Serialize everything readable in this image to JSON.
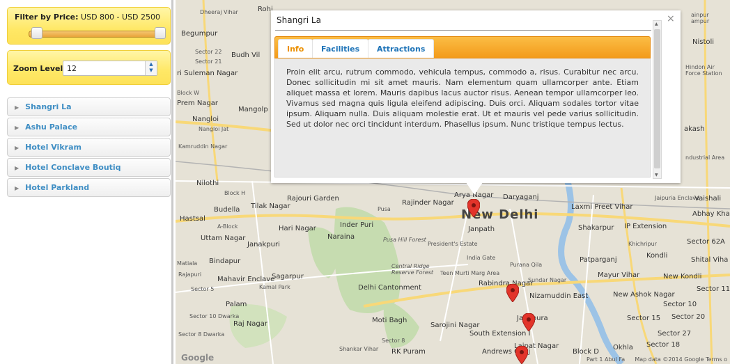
{
  "filters": {
    "price_label": "Filter by Price:",
    "price_range": "USD 800 - USD 2500",
    "zoom_label": "Zoom Level:",
    "zoom_value": "12"
  },
  "hotels": [
    "Shangri La",
    "Ashu Palace",
    "Hotel Vikram",
    "Hotel Conclave Boutiq",
    "Hotel Parkland"
  ],
  "infowindow": {
    "title": "Shangri La",
    "tabs": [
      "Info",
      "Facilities",
      "Attractions"
    ],
    "active_tab": "Info",
    "body": "Proin elit arcu, rutrum commodo, vehicula tempus, commodo a, risus. Curabitur nec arcu. Donec sollicitudin mi sit amet mauris. Nam elementum quam ullamcorper ante. Etiam aliquet massa et lorem. Mauris dapibus lacus auctor risus. Aenean tempor ullamcorper leo. Vivamus sed magna quis ligula eleifend adipiscing. Duis orci. Aliquam sodales tortor vitae ipsum. Aliquam nulla. Duis aliquam molestie erat. Ut et mauris vel pede varius sollicitudin. Sed ut dolor nec orci tincidunt interdum. Phasellus ipsum. Nunc tristique tempus lectus."
  },
  "map": {
    "city": "New Delhi",
    "labels": {
      "dheeraj_vihar": "Dheeraj Vihar",
      "rohini": "Rohi",
      "begumpur": "Begumpur",
      "sector_22": "Sector 22",
      "sector_21": "Sector 21",
      "budh_vihar": "Budh Vil",
      "sultanpuri": "ri Suleman Nagar",
      "block_w": "Block W",
      "prem_nagar": "Prem Nagar",
      "mangolpuri": "Mangolp",
      "nangloi": "Nangloi",
      "nangloi_jat": "Nangloi Jat",
      "kamruddin": "Kamruddin Nagar",
      "nilothi": "Nilothi",
      "block_h": "Block H",
      "budella": "Budella",
      "tilak_nagar": "Tilak Nagar",
      "hastsal": "Hastsal",
      "a_block": "A-Block",
      "hari_nagar": "Hari Nagar",
      "uttam_nagar": "Uttam Nagar",
      "janakpuri": "Janakpuri",
      "bindapur": "Bindapur",
      "matiala": "Matiala",
      "rajapuri": "Rajapuri",
      "mahavir": "Mahavir Enclave",
      "sagarpur": "Sagarpur",
      "sector_5": "Sector 5",
      "kamal_park": "Kamal Park",
      "palam": "Palam",
      "sector_10": "Sector 10 Dwarka",
      "raj_nagar": "Raj Nagar",
      "sector_8": "Sector 8 Dwarka",
      "sector_22b": "Sector 22",
      "rajouri": "Rajouri Garden",
      "inder_puri": "Inder Puri",
      "naraina": "Naraina",
      "pusa": "Pusa",
      "rajinder": "Rajinder Nagar",
      "pusa_hill": "Pusa Hill Forest",
      "central_ridge": "Central Ridge Reserve Forest",
      "delhi_cantt": "Delhi Cantonment",
      "moti_bagh": "Moti Bagh",
      "sarojini": "Sarojini Nagar",
      "sector_8b": "Sector 8",
      "rk_puram": "RK Puram",
      "shankar": "Shankar Vihar",
      "arya_nagar": "Arya Nagar",
      "daryaganj": "Daryaganj",
      "janpath": "Janpath",
      "presidents": "President's Estate",
      "india_gate": "India Gate",
      "purana_qila": "Purana Qila",
      "teen_murti": "Teen Murti Marg Area",
      "rabindra": "Rabindra Nagar",
      "sundar": "Sundar Nagar",
      "nizamuddin": "Nizamuddin East",
      "jangpura": "Jangpura",
      "south_ext": "South Extension I",
      "andrews": "Andrews Ganj",
      "lajpat": "Lajpat Nagar",
      "block_d": "Block D",
      "okhla": "Okhla",
      "part1": "Part 1 Abul Fa",
      "laxmi": "Laxmi Preet Vihar",
      "jaipuria": "Jaipuria Enclave",
      "vaishali": "Vaishali",
      "abhay": "Abhay Khand",
      "shakarpur": "Shakarpur",
      "ip_ext": "IP Extension",
      "sector_62a": "Sector 62A",
      "khichripur": "Khichripur",
      "kondli": "Kondli",
      "patparganj": "Patparganj",
      "shital": "Shital Viha",
      "mayur": "Mayur Vihar",
      "new_kondli": "New Kondli",
      "sector_11": "Sector 11",
      "new_ashok": "New Ashok Nagar",
      "sector_10b": "Sector 10",
      "sector_15": "Sector 15",
      "sector_20": "Sector 20",
      "sector_27": "Sector 27",
      "sector_18": "Sector 18",
      "hindon": "Hindon Air Force Station",
      "akash": "akash",
      "industrial": "ndustrial Area",
      "nistoli": "Nistoli",
      "dilshad": "ainpur ampur"
    },
    "copyright": "Map data ©2014 Google",
    "terms": "Terms o",
    "logo_text": "Google"
  },
  "colors": {
    "accent": "#f39b1b",
    "link": "#1f74b8",
    "highlight": "#ffe866"
  },
  "icons": [
    "close-icon",
    "map-pin-icon",
    "chevron-right-icon",
    "spinner-up-icon",
    "spinner-down-icon"
  ]
}
